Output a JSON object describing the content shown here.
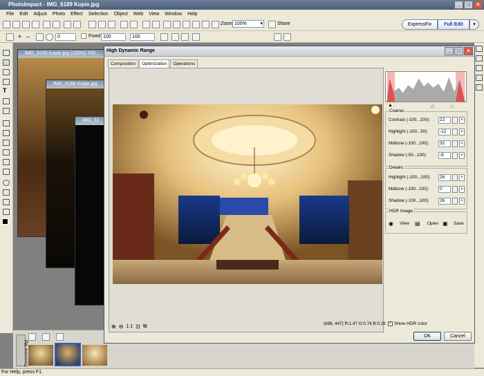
{
  "app": {
    "title": "PhotoImpact - IMG_6189 Kopie.jpg",
    "menu": [
      "File",
      "Edit",
      "Adjust",
      "Photo",
      "Effect",
      "Selection",
      "Object",
      "Web",
      "View",
      "Window",
      "Help"
    ],
    "zoom_label": "Zoom",
    "zoom_value": "100%",
    "share_label": "Share",
    "fixed_label": "Fixed",
    "width_value": "100",
    "height_value": "100",
    "size_value": "0",
    "mode_expressfix": "ExpressFix",
    "mode_fulledit": "Full Edit",
    "status": "For Help, press F1."
  },
  "documents": [
    {
      "title": "IMG_6190 Kopie.jpg (100%) 700..."
    },
    {
      "title": "IMG_6188 Kopie.jpg"
    },
    {
      "title": "IMG_61"
    }
  ],
  "docmanager_label": "Document Mgr",
  "dialog": {
    "title": "High Dynamic Range",
    "tabs": [
      "Composition",
      "Optimization",
      "Operations"
    ],
    "active_tab": 1,
    "zoom_ratio": "1:1",
    "readout": "(698, 447) R:1.47 G:0.74 B:0.28",
    "show_hdr_label": "Show HDR color",
    "coarse": {
      "label": "Coarse",
      "rows": [
        {
          "label": "Contrast (-100...100):",
          "value": "22"
        },
        {
          "label": "Highlight (-100...50):",
          "value": "-12"
        },
        {
          "label": "Midtone (-100...100):",
          "value": "32"
        },
        {
          "label": "Shadow (-50...100):",
          "value": "-8"
        }
      ]
    },
    "details": {
      "label": "Details",
      "rows": [
        {
          "label": "Highlight (-100...100):",
          "value": "26"
        },
        {
          "label": "Midtone (-100...100):",
          "value": "0"
        },
        {
          "label": "Shadow (-100...100):",
          "value": "26"
        }
      ]
    },
    "hdr_image": {
      "label": "HDR Image",
      "view": "View",
      "open": "Open",
      "save": "Save"
    },
    "ok": "OK",
    "cancel": "Cancel"
  },
  "colors": {
    "titlebar": "#4a5e78",
    "dialog_bg": "#ece9d8",
    "histogram_clip": "#e05050",
    "fulledit_accent": "#3a6fd8"
  }
}
